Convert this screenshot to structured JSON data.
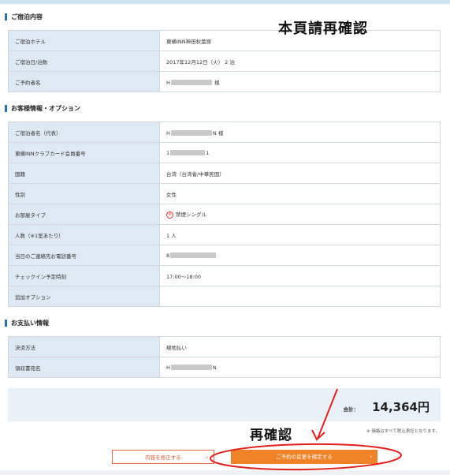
{
  "sections": {
    "stay": {
      "title": "ご宿泊内容",
      "rows": [
        {
          "label": "ご宿泊ホテル",
          "value": "東横INN神田秋葉原"
        },
        {
          "label": "ご宿泊日/泊数",
          "value": "2017年12月12日（火） 2 泊"
        },
        {
          "label": "ご予約者名",
          "prefix": "H",
          "suffix": " 様"
        }
      ]
    },
    "guest": {
      "title": "お客様情報・オプション",
      "rows": [
        {
          "label": "ご宿泊者名（代表）",
          "prefix": "H",
          "suffix": "N 様"
        },
        {
          "label": "東横INNクラブカード会員番号",
          "prefix": "1",
          "suffix": "1"
        },
        {
          "label": "国籍",
          "value": "台湾（台湾省/中華民国）"
        },
        {
          "label": "性別",
          "value": "女性"
        },
        {
          "label": "お部屋タイプ",
          "value": "禁煙シングル"
        },
        {
          "label": "人数（※1室あたり）",
          "value": "1 人"
        },
        {
          "label": "当日のご連絡先お電話番号",
          "prefix": "8",
          "suffix": ""
        },
        {
          "label": "チェックイン予定時刻",
          "value": "17:00～18:00"
        },
        {
          "label": "追加オプション",
          "value": ""
        }
      ]
    },
    "payment": {
      "title": "お支払い情報",
      "rows": [
        {
          "label": "決済方法",
          "value": "現地払い"
        },
        {
          "label": "領収書宛名",
          "prefix": "H",
          "suffix": "N"
        }
      ]
    }
  },
  "total": {
    "label": "合計：",
    "amount": "14,364円"
  },
  "tax_note": "※ 価格はすべて税込表記となります。",
  "buttons": {
    "edit": "内容を修正する",
    "confirm": "ご予約の変更を確定する",
    "chevron": "›"
  },
  "annotations": {
    "top": "本頁請再確認",
    "bottom": "再確認"
  },
  "icons": {
    "nosmoke": "no-smoking-icon",
    "nosmoke_glyph": "⊘"
  },
  "colors": {
    "accent": "#f08227",
    "annotation": "#e0201b",
    "label_bg": "#dfe9f3",
    "section_bar": "#2f6fae"
  }
}
